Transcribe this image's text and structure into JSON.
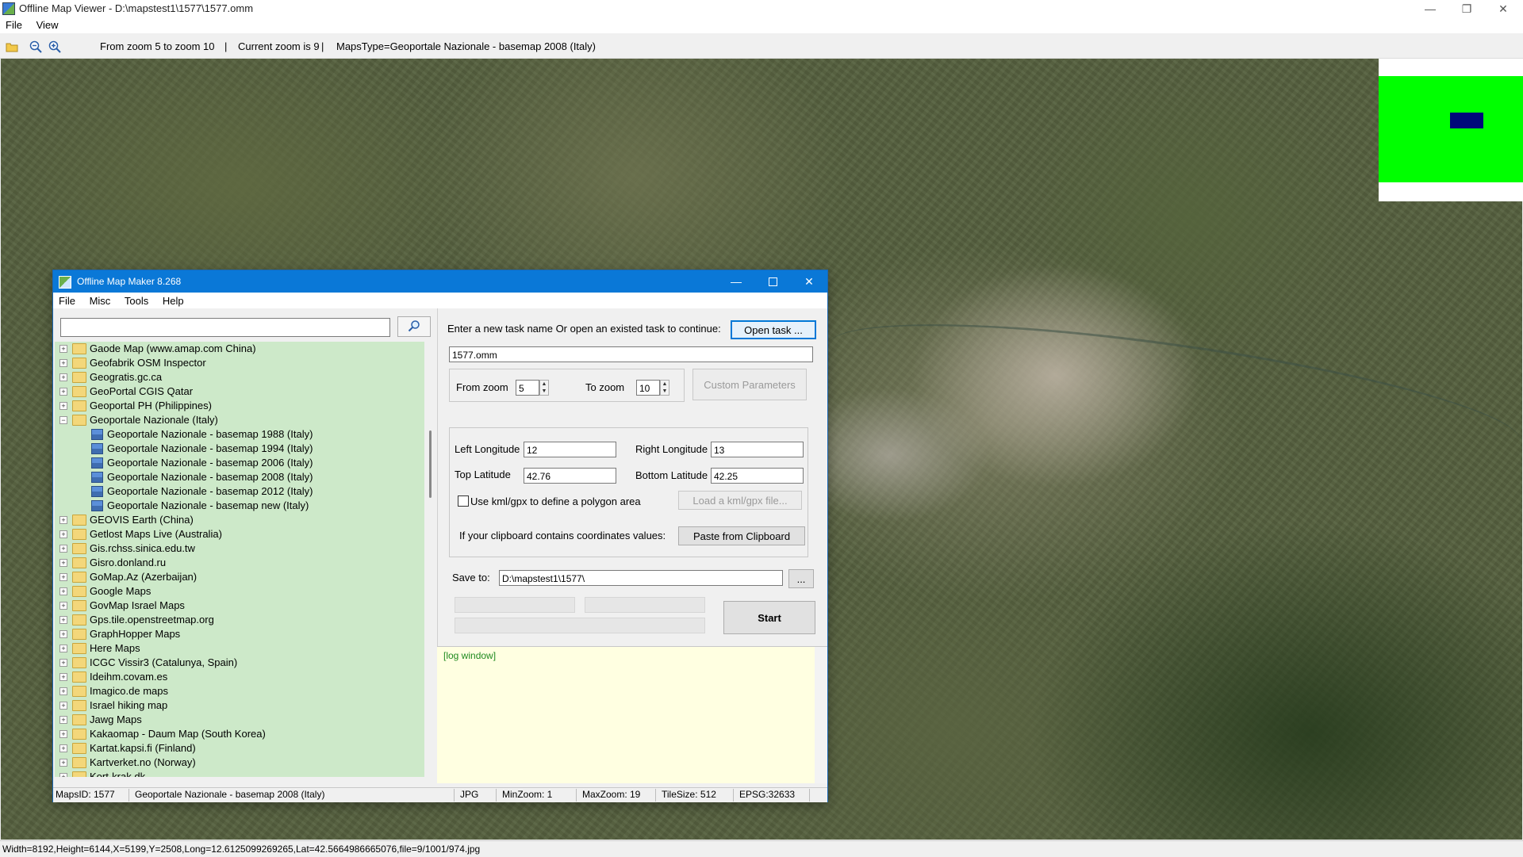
{
  "window": {
    "title": "Offline Map Viewer - D:\\mapstest1\\1577\\1577.omm",
    "menu": [
      "File",
      "View"
    ],
    "minimize": "—",
    "maximize": "❐",
    "close": "✕"
  },
  "toolbar": {
    "zoom_range": "From zoom 5 to zoom 10",
    "current_zoom": "Current zoom is 9",
    "maps_type": "MapsType=Geoportale Nazionale - basemap 2008 (Italy)",
    "sep1": "|",
    "sep2": "|"
  },
  "statusbar": {
    "text": "Width=8192,Height=6144,X=5199,Y=2508,Long=12.6125099269265,Lat=42.5664986665076,file=9/1001/974.jpg"
  },
  "dialog": {
    "title": "Offline Map Maker 8.268",
    "menu": [
      "File",
      "Misc",
      "Tools",
      "Help"
    ],
    "search_placeholder": "",
    "tree": [
      {
        "label": "Gaode Map (www.amap.com China)",
        "type": "folder",
        "level": 0
      },
      {
        "label": "Geofabrik OSM Inspector",
        "type": "folder",
        "level": 0
      },
      {
        "label": "Geogratis.gc.ca",
        "type": "folder",
        "level": 0
      },
      {
        "label": "GeoPortal CGIS Qatar",
        "type": "folder",
        "level": 0
      },
      {
        "label": "Geoportal PH (Philippines)",
        "type": "folder",
        "level": 0
      },
      {
        "label": "Geoportale Nazionale (Italy)",
        "type": "folder-open",
        "level": 0
      },
      {
        "label": "Geoportale Nazionale - basemap 1988 (Italy)",
        "type": "map",
        "level": 1
      },
      {
        "label": "Geoportale Nazionale - basemap 1994 (Italy)",
        "type": "map",
        "level": 1
      },
      {
        "label": "Geoportale Nazionale - basemap 2006 (Italy)",
        "type": "map",
        "level": 1
      },
      {
        "label": "Geoportale Nazionale - basemap 2008 (Italy)",
        "type": "map",
        "level": 1
      },
      {
        "label": "Geoportale Nazionale - basemap 2012 (Italy)",
        "type": "map",
        "level": 1
      },
      {
        "label": "Geoportale Nazionale - basemap new (Italy)",
        "type": "map",
        "level": 1
      },
      {
        "label": "GEOVIS Earth (China)",
        "type": "folder",
        "level": 0
      },
      {
        "label": "Getlost Maps Live (Australia)",
        "type": "folder",
        "level": 0
      },
      {
        "label": "Gis.rchss.sinica.edu.tw",
        "type": "folder",
        "level": 0
      },
      {
        "label": "Gisro.donland.ru",
        "type": "folder",
        "level": 0
      },
      {
        "label": "GoMap.Az (Azerbaijan)",
        "type": "folder",
        "level": 0
      },
      {
        "label": "Google Maps",
        "type": "folder",
        "level": 0
      },
      {
        "label": "GovMap Israel Maps",
        "type": "folder",
        "level": 0
      },
      {
        "label": "Gps.tile.openstreetmap.org",
        "type": "folder",
        "level": 0
      },
      {
        "label": "GraphHopper Maps",
        "type": "folder",
        "level": 0
      },
      {
        "label": "Here Maps",
        "type": "folder",
        "level": 0
      },
      {
        "label": "ICGC Vissir3 (Catalunya, Spain)",
        "type": "folder",
        "level": 0
      },
      {
        "label": "Ideihm.covam.es",
        "type": "folder",
        "level": 0
      },
      {
        "label": "Imagico.de maps",
        "type": "folder",
        "level": 0
      },
      {
        "label": "Israel hiking map",
        "type": "folder",
        "level": 0
      },
      {
        "label": "Jawg Maps",
        "type": "folder",
        "level": 0
      },
      {
        "label": "Kakaomap - Daum Map (South Korea)",
        "type": "folder",
        "level": 0
      },
      {
        "label": "Kartat.kapsi.fi (Finland)",
        "type": "folder",
        "level": 0
      },
      {
        "label": "Kartverket.no (Norway)",
        "type": "folder",
        "level": 0
      },
      {
        "label": "Kort-krak.dk",
        "type": "folder",
        "level": 0
      }
    ],
    "task_prompt": "Enter a new task name Or open an existed task to continue:",
    "open_task": "Open task ...",
    "task_name": "1577.omm",
    "from_zoom_label": "From zoom",
    "from_zoom": "5",
    "to_zoom_label": "To zoom",
    "to_zoom": "10",
    "custom_params": "Custom Parameters",
    "left_lon_label": "Left Longitude",
    "left_lon": "12",
    "right_lon_label": "Right Longitude",
    "right_lon": "13",
    "top_lat_label": "Top Latitude",
    "top_lat": "42.76",
    "bottom_lat_label": "Bottom Latitude",
    "bottom_lat": "42.25",
    "kml_checkbox": "Use kml/gpx to define a polygon area",
    "load_kml": "Load a kml/gpx file...",
    "clipboard_prompt": "If your clipboard contains coordinates values:",
    "paste_clipboard": "Paste from Clipboard",
    "save_label": "Save to:",
    "save_path": "D:\\mapstest1\\1577\\",
    "browse": "...",
    "start": "Start",
    "log": "[log window]",
    "status": {
      "maps_id": "MapsID: 1577",
      "map_name": "Geoportale Nazionale - basemap 2008 (Italy)",
      "format": "JPG",
      "min_zoom": "MinZoom: 1",
      "max_zoom": "MaxZoom: 19",
      "tile_size": "TileSize: 512",
      "epsg": "EPSG:32633"
    }
  }
}
